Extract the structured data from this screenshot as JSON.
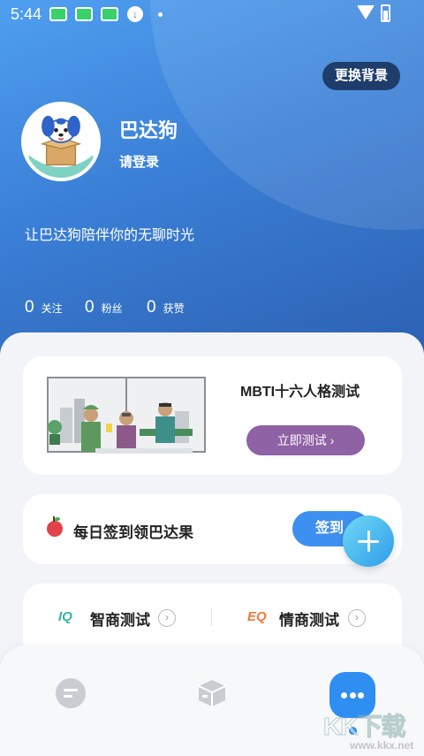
{
  "status_bar": {
    "time": "5:44",
    "icons": [
      "app-notification-icon",
      "app-notification-icon",
      "app-notification-icon",
      "download-icon",
      "dot-icon",
      "wifi-icon",
      "battery-icon"
    ]
  },
  "header": {
    "change_background": "更换背景",
    "username": "巴达狗",
    "login_prompt": "请登录",
    "motto": "让巴达狗陪伴你的无聊时光"
  },
  "stats": [
    {
      "value": "0",
      "label": "关注"
    },
    {
      "value": "0",
      "label": "粉丝"
    },
    {
      "value": "0",
      "label": "获赞"
    }
  ],
  "mbti_card": {
    "title": "MBTI十六人格测试",
    "button": "立即测试",
    "button_arrow": "›"
  },
  "checkin_card": {
    "text": "每日签到领巴达果",
    "button": "签到"
  },
  "quiz_card": {
    "items": [
      {
        "icon_text": "IQ",
        "label": "智商测试",
        "icon_color": "#2fb6a8"
      },
      {
        "icon_text": "EQ",
        "label": "情商测试",
        "icon_color": "#f07a3a"
      }
    ],
    "chevron": "›"
  },
  "tab_bar": {
    "tabs": [
      "message-icon",
      "box-icon",
      "chat-icon"
    ]
  },
  "watermark": {
    "logo": "KK下载",
    "url": "www.kkx.net"
  },
  "colors": {
    "hero_top": "#4f9ff0",
    "hero_bottom": "#2c5fb0",
    "accent_blue": "#3d8ff0",
    "mbti_button": "#8e62a5"
  }
}
